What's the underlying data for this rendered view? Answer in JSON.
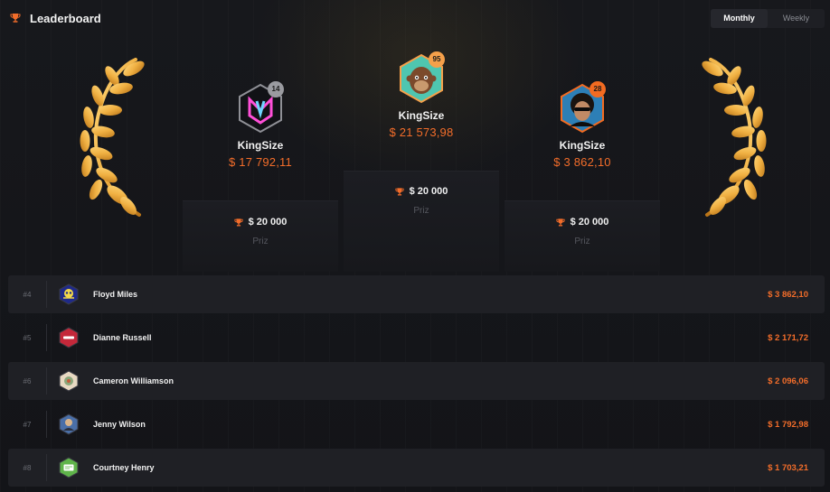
{
  "header": {
    "title": "Leaderboard",
    "icon": "trophy-icon"
  },
  "tabs": [
    {
      "label": "Monthly",
      "active": true
    },
    {
      "label": "Weekly",
      "active": false
    }
  ],
  "podium": {
    "first": {
      "name": "KingSize",
      "amount": "$ 21 573,98",
      "badge": "95",
      "prize": "$ 20 000",
      "prize_label": "Priz",
      "badge_color": "#f5a04a"
    },
    "second": {
      "name": "KingSize",
      "amount": "$ 17 792,11",
      "badge": "14",
      "prize": "$ 20 000",
      "prize_label": "Priz",
      "badge_color": "#9a9ba0"
    },
    "third": {
      "name": "KingSize",
      "amount": "$ 3 862,10",
      "badge": "28",
      "prize": "$ 20 000",
      "prize_label": "Priz",
      "badge_color": "#f26b21"
    }
  },
  "rows": [
    {
      "rank": "#4",
      "name": "Floyd Miles",
      "amount": "$ 3 862,10"
    },
    {
      "rank": "#5",
      "name": "Dianne Russell",
      "amount": "$ 2 171,72"
    },
    {
      "rank": "#6",
      "name": "Cameron Williamson",
      "amount": "$ 2 096,06"
    },
    {
      "rank": "#7",
      "name": "Jenny Wilson",
      "amount": "$ 1 792,98"
    },
    {
      "rank": "#8",
      "name": "Courtney Henry",
      "amount": "$ 1 703,21"
    }
  ],
  "colors": {
    "accent": "#f36d2a",
    "gold": "#f0b64a",
    "background": "#15161a"
  }
}
